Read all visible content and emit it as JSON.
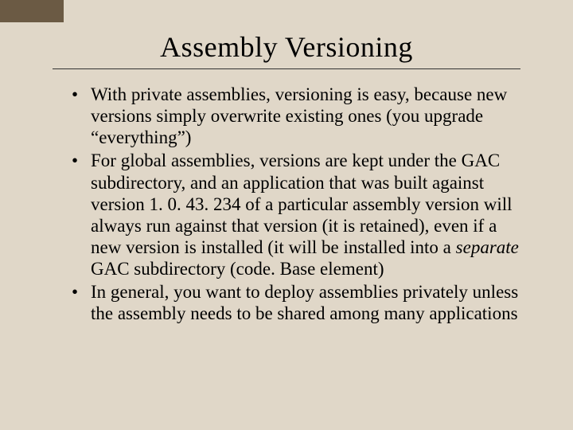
{
  "slide": {
    "title": "Assembly Versioning",
    "bullets": [
      {
        "pre": "With private assemblies, versioning is easy, because new versions simply overwrite existing ones (you upgrade “everything”)",
        "italic": "",
        "post": ""
      },
      {
        "pre": "For global assemblies, versions are kept under the GAC subdirectory, and an application that was built against version 1. 0. 43. 234 of a particular assembly version will always run against that version (it is retained), even if a new version is installed (it will be installed into a ",
        "italic": "separate",
        "post": " GAC subdirectory (code. Base element)"
      },
      {
        "pre": "In general, you want to deploy assemblies privately unless the assembly needs to be shared among many applications",
        "italic": "",
        "post": ""
      }
    ]
  }
}
